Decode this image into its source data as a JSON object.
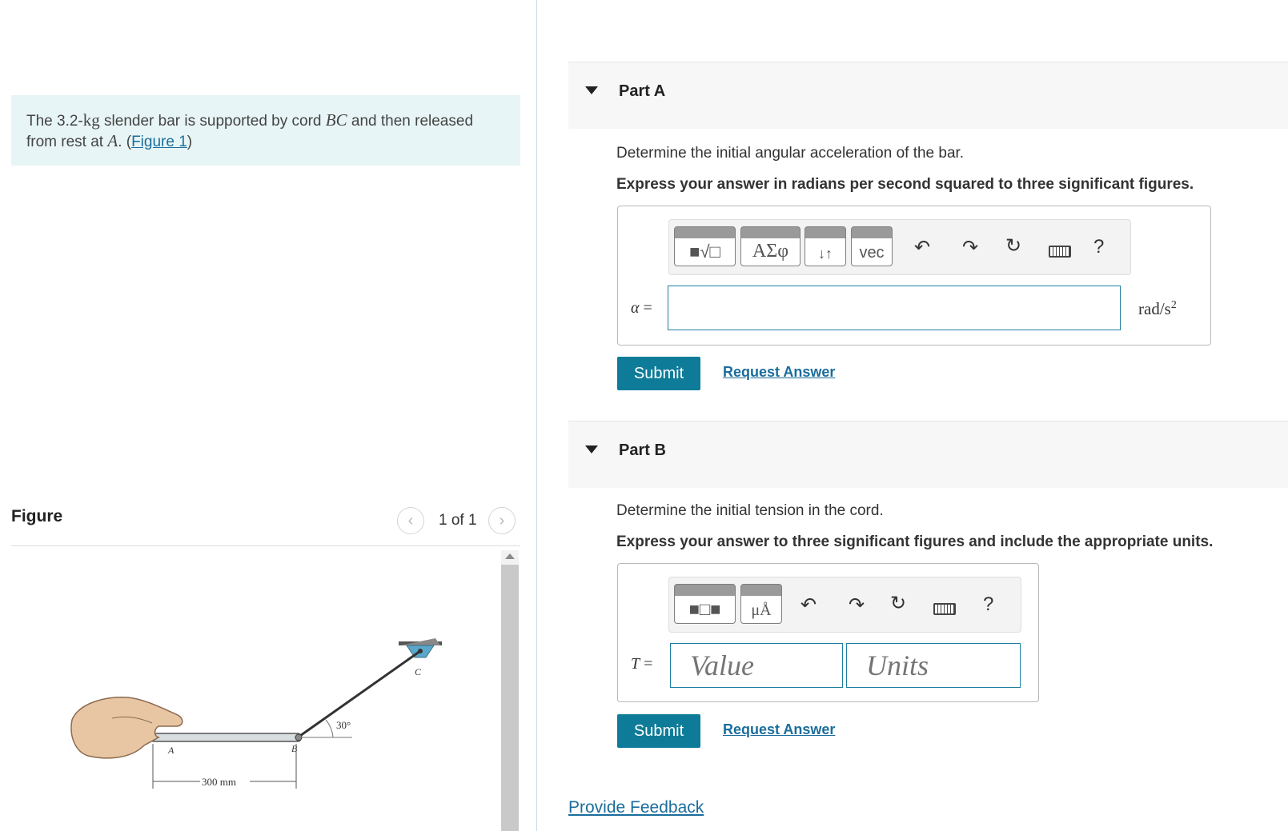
{
  "intro": {
    "text_before_mass": "The 3.2-",
    "mass_unit": "kg",
    "text_after_mass": " slender bar is supported by cord ",
    "cord": "BC",
    "text_before_point": " and then released from rest at ",
    "point": "A",
    "text_before_link": ". (",
    "figure_link": "Figure 1",
    "text_after_link": ")"
  },
  "figure_panel": {
    "heading": "Figure",
    "pager_text": "1 of 1",
    "prev_icon": "chevron-left-icon",
    "next_icon": "chevron-right-icon",
    "labels": {
      "angle": "30°",
      "point_a": "A",
      "point_b": "B",
      "point_c": "C",
      "length": "300 mm"
    }
  },
  "part_a": {
    "title": "Part A",
    "question": "Determine the initial angular acceleration of the bar.",
    "instruction": "Express your answer in radians per second squared to three significant figures.",
    "variable": "α",
    "equals": "=",
    "value": "",
    "unit_base": "rad/s",
    "unit_exp": "2",
    "toolbar": {
      "greek": "ΑΣφ",
      "arrows": "↓↑",
      "vec": "vec",
      "help": "?",
      "icons": [
        "templates-icon",
        "greek-letters-icon",
        "arrows-icon",
        "vector-icon",
        "undo-icon",
        "redo-icon",
        "reset-icon",
        "keyboard-icon",
        "help-icon"
      ]
    },
    "submit": "Submit",
    "request": "Request Answer"
  },
  "part_b": {
    "title": "Part B",
    "question": "Determine the initial tension in the cord.",
    "instruction": "Express your answer to three significant figures and include the appropriate units.",
    "variable": "T",
    "equals": "=",
    "value_placeholder": "Value",
    "units_placeholder": "Units",
    "toolbar": {
      "units": "μÅ",
      "help": "?",
      "icons": [
        "templates-icon",
        "units-icon",
        "undo-icon",
        "redo-icon",
        "reset-icon",
        "keyboard-icon",
        "help-icon"
      ]
    },
    "submit": "Submit",
    "request": "Request Answer"
  },
  "feedback": "Provide Feedback",
  "colors": {
    "accent": "#0e7c99",
    "link": "#1a6d9c",
    "intro_bg": "#e8f5f6"
  }
}
